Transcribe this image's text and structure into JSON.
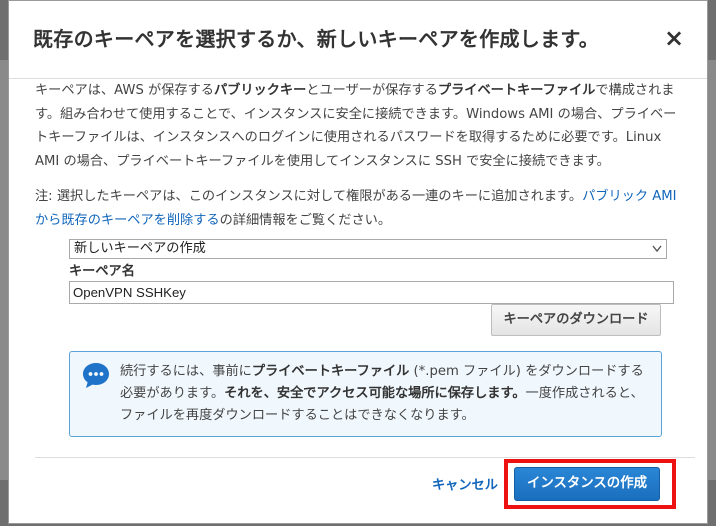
{
  "dialog": {
    "title": "既存のキーペアを選択するか、新しいキーペアを作成します。",
    "close_label": "×"
  },
  "intro": {
    "t1": "キーペアは、AWS が保存する",
    "b1": "パブリックキー",
    "t2": "とユーザーが保存する",
    "b2": "プライベートキーファイル",
    "t3": "で構成されます。組み合わせて使用することで、インスタンスに安全に接続できます。Windows AMI の場合、プライベートキーファイルは、インスタンスへのログインに使用されるパスワードを取得するために必要です。Linux AMI の場合、プライベートキーファイルを使用してインスタンスに SSH で安全に接続できます。"
  },
  "note": {
    "t1": "注: 選択したキーペアは、このインスタンスに対して権限がある一連のキーに追加されます。",
    "link": "パブリック AMI から既存のキーペアを削除する",
    "t2": "の詳細情報をご覧ください。"
  },
  "keypair_select": {
    "selected": "新しいキーペアの作成"
  },
  "keypair_name": {
    "label": "キーペア名",
    "value": "OpenVPN SSHKey"
  },
  "download_button": "キーペアのダウンロード",
  "info": {
    "t1": "続行するには、事前に",
    "b1": "プライベートキーファイル",
    "t2": " (*.pem ファイル) をダウンロードする必要があります。",
    "b2": "それを、安全でアクセス可能な場所に保存します。",
    "t3": "一度作成されると、ファイルを再度ダウンロードすることはできなくなります。"
  },
  "footer": {
    "cancel": "キャンセル",
    "launch": "インスタンスの作成"
  },
  "colors": {
    "primary": "#1a6fbd",
    "link": "#1166bb",
    "highlight": "#ee1111",
    "info_bg": "#f1f8fd"
  }
}
